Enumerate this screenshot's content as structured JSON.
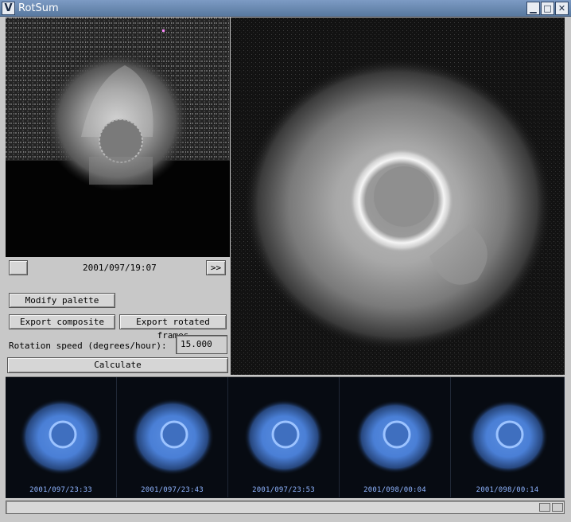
{
  "window": {
    "title": "RotSum",
    "menu_glyph": "V",
    "minimize_glyph": "▁",
    "maximize_glyph": "□",
    "close_glyph": "✕"
  },
  "controls": {
    "prev_label": "",
    "timestamp": "2001/097/19:07",
    "next_label": ">>",
    "modify_palette_label": "Modify palette",
    "export_composite_label": "Export composite",
    "export_rotated_label": "Export rotated frames",
    "rotation_speed_label": "Rotation speed (degrees/hour):",
    "rotation_speed_value": "15.000",
    "calculate_label": "Calculate"
  },
  "thumbnails": [
    {
      "caption": "2001/097/23:33"
    },
    {
      "caption": "2001/097/23:43"
    },
    {
      "caption": "2001/097/23:53"
    },
    {
      "caption": "2001/098/00:04"
    },
    {
      "caption": "2001/098/00:14"
    }
  ],
  "colors": {
    "titlebar": "#6b8ab3",
    "thumb_glow": "#5a8ee0",
    "caption": "#8fb4ff"
  }
}
